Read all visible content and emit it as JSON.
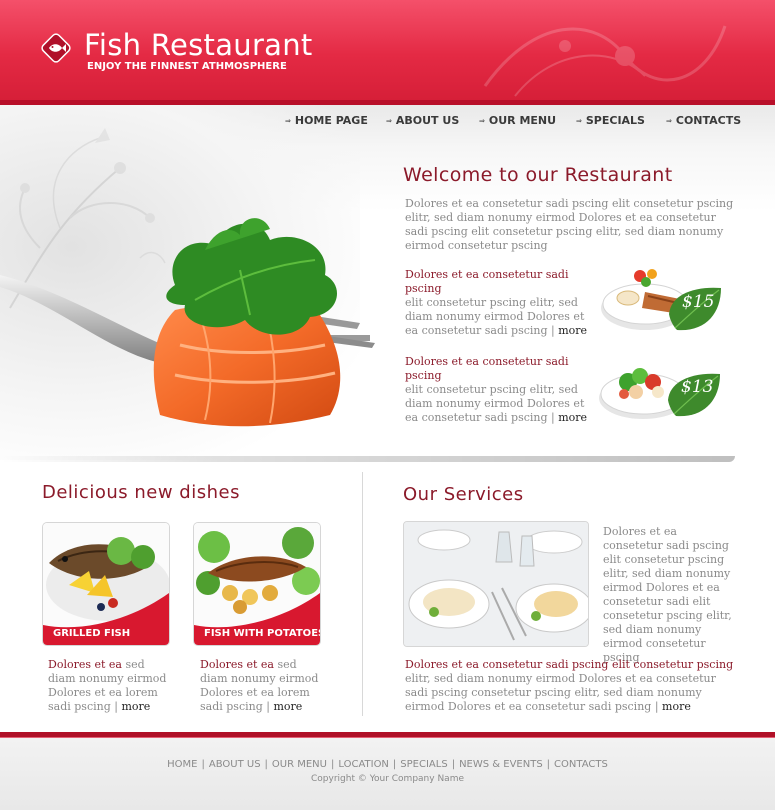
{
  "header": {
    "title": "Fish Restaurant",
    "tagline": "ENJOY THE FINNEST ATHMOSPHERE"
  },
  "nav": [
    {
      "label": "HOME PAGE",
      "name": "nav-home-page"
    },
    {
      "label": "ABOUT US",
      "name": "nav-about-us"
    },
    {
      "label": "OUR MENU",
      "name": "nav-our-menu"
    },
    {
      "label": "SPECIALS",
      "name": "nav-specials"
    },
    {
      "label": "CONTACTS",
      "name": "nav-contacts"
    }
  ],
  "welcome": {
    "title": "Welcome to our Restaurant",
    "text": "Dolores et ea consetetur sadi pscing elit consetetur pscing elitr, sed diam nonumy eirmod Dolores et ea consetetur sadi pscing elit consetetur pscing elitr, sed diam nonumy eirmod  consetetur pscing"
  },
  "offers": [
    {
      "head": "Dolores et ea consetetur sadi pscing",
      "text": "elit consetetur pscing elitr, sed diam nonumy eirmod Dolores et ea consetetur sadi pscing",
      "more": "more",
      "price": "$15"
    },
    {
      "head": "Dolores et ea consetetur sadi pscing",
      "text": "elit consetetur pscing elitr, sed diam nonumy eirmod Dolores et ea consetetur sadi pscing",
      "more": "more",
      "price": "$13"
    }
  ],
  "dishes": {
    "title": "Delicious new dishes",
    "items": [
      {
        "caption": "GRILLED FISH",
        "head": "Dolores et ea",
        "text": " sed diam nonumy eirmod Dolores et ea lorem sadi pscing",
        "more": "more"
      },
      {
        "caption": "FISH WITH POTATOES",
        "head": "Dolores et ea",
        "text": " sed diam nonumy eirmod Dolores et ea lorem sadi pscing",
        "more": "more"
      }
    ]
  },
  "services": {
    "title": "Our Services",
    "side_text": "Dolores et ea consetetur sadi pscing elit consetetur pscing elitr, sed diam nonumy eirmod Dolores et ea consetetur sadi elit consetetur pscing elitr, sed diam nonumy eirmod consetetur pscing",
    "head": "Dolores et ea consetetur sadi pscing elit consetetur pscing",
    "text": " elitr, sed diam nonumy eirmod Dolores et ea consetetur sadi pscing consetetur pscing elitr, sed diam nonumy eirmod Dolores et ea consetetur sadi pscing",
    "more": "more"
  },
  "footer": {
    "links": [
      "HOME",
      "ABOUT US",
      "OUR MENU",
      "LOCATION",
      "SPECIALS",
      "NEWS & EVENTS",
      "CONTACTS"
    ],
    "separator": "|",
    "copyright": "Copyright © Your Company Name"
  },
  "colors": {
    "brand_red": "#e42a44",
    "accent_maroon": "#8b1a2a",
    "price_green": "#3e8a2c"
  }
}
